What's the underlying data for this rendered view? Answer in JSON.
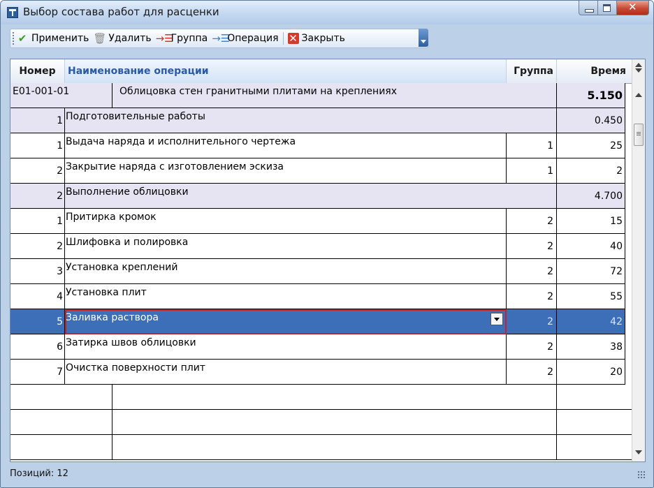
{
  "window": {
    "title": "Выбор состава работ для расценки"
  },
  "toolbar": {
    "apply_label": "Применить",
    "delete_label": "Удалить",
    "group_label": "Группа",
    "operation_label": "Операция",
    "close_label": "Закрыть"
  },
  "table": {
    "headers": {
      "num": "Номер",
      "name": "Наименование операции",
      "group": "Группа",
      "time": "Время"
    },
    "top_row": {
      "code": "E01-001-01",
      "name": "Облицовка стен гранитными плитами на креплениях",
      "time": "5.150"
    },
    "rows": [
      {
        "type": "group",
        "num": "1",
        "name": "Подготовительные работы",
        "group": "",
        "time": "0.450"
      },
      {
        "type": "op",
        "num": "1",
        "name": "Выдача наряда и исполнительного чертежа",
        "group": "1",
        "time": "25"
      },
      {
        "type": "op",
        "num": "2",
        "name": "Закрытие наряда с изготовлением эскиза",
        "group": "1",
        "time": "2"
      },
      {
        "type": "group",
        "num": "2",
        "name": "Выполнение облицовки",
        "group": "",
        "time": "4.700"
      },
      {
        "type": "op",
        "num": "1",
        "name": "Притирка кромок",
        "group": "2",
        "time": "15"
      },
      {
        "type": "op",
        "num": "2",
        "name": "Шлифовка и полировка",
        "group": "2",
        "time": "40"
      },
      {
        "type": "op",
        "num": "3",
        "name": "Установка креплений",
        "group": "2",
        "time": "72"
      },
      {
        "type": "op",
        "num": "4",
        "name": "Установка плит",
        "group": "2",
        "time": "55"
      },
      {
        "type": "selected",
        "num": "5",
        "name": "Заливка раствора",
        "group": "2",
        "time": "42"
      },
      {
        "type": "op",
        "num": "6",
        "name": "Затирка швов облицовки",
        "group": "2",
        "time": "38"
      },
      {
        "type": "op",
        "num": "7",
        "name": "Очистка поверхности плит",
        "group": "2",
        "time": "20"
      }
    ]
  },
  "status": {
    "text": "Позиций: 12"
  },
  "colors": {
    "selection": "#3d6fb8",
    "group_row": "#e6e4f3",
    "header_accent": "#2a5aa8"
  }
}
